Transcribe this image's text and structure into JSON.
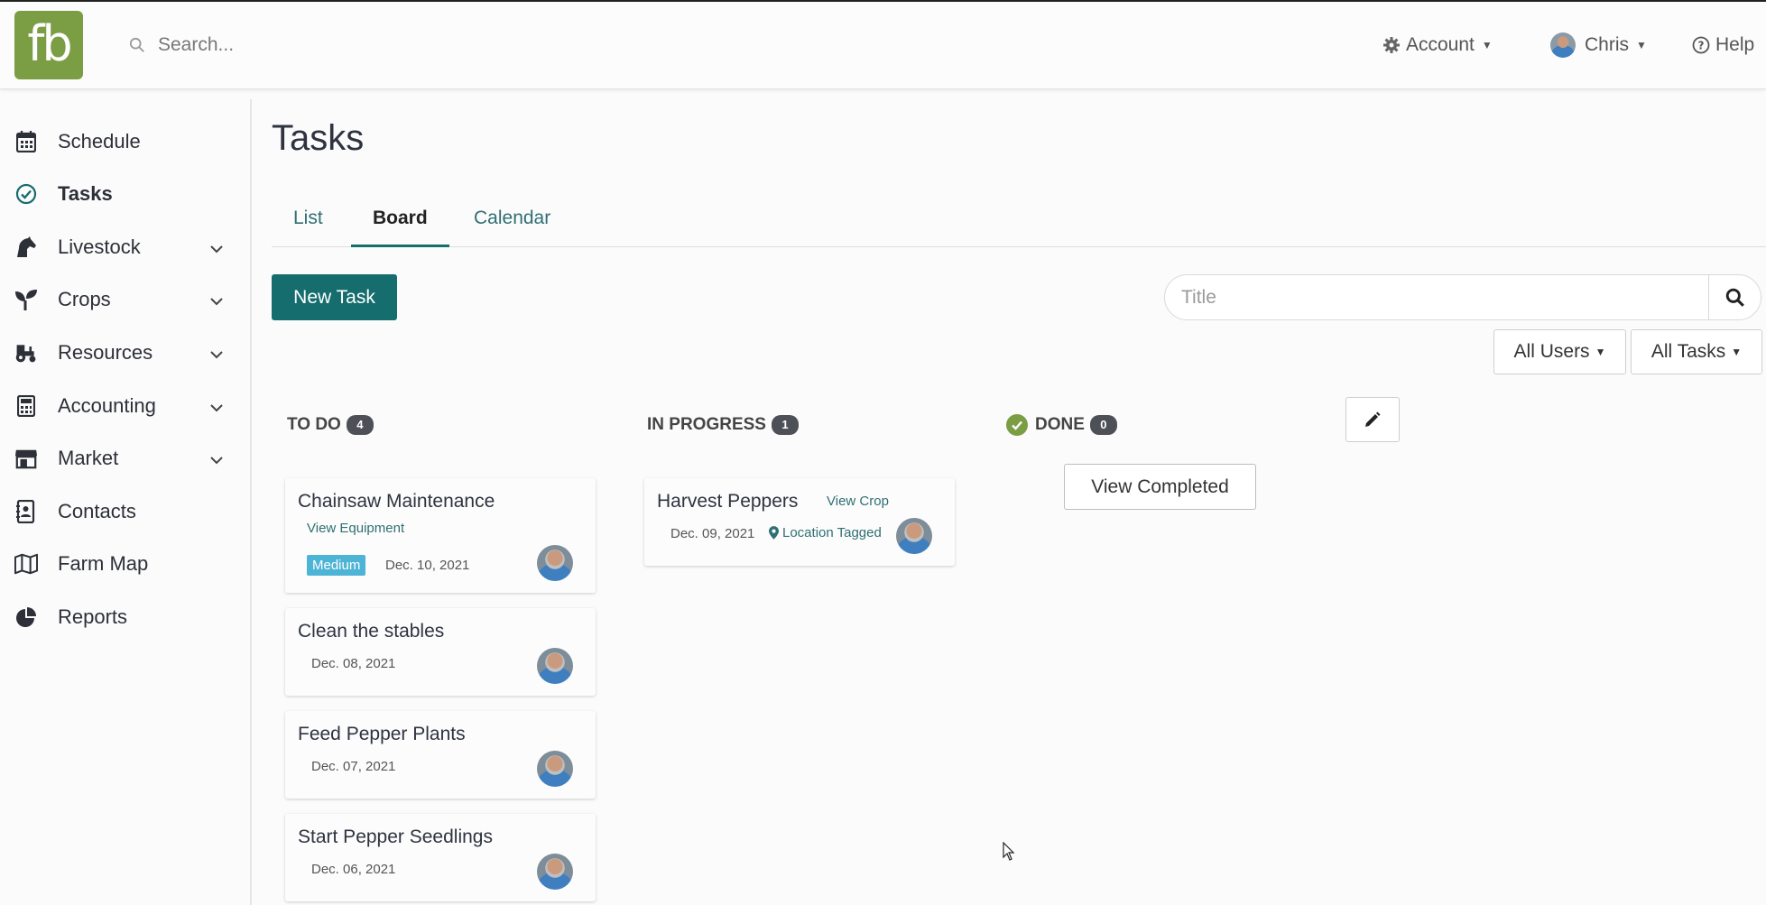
{
  "brand": {
    "logo_text": "fb",
    "color": "#7b9e45"
  },
  "search": {
    "placeholder": "Search..."
  },
  "topnav": {
    "account_label": "Account",
    "user_label": "Chris",
    "help_label": "Help"
  },
  "sidebar": {
    "items": [
      {
        "label": "Schedule",
        "icon": "calendar-icon",
        "expandable": false,
        "active": false
      },
      {
        "label": "Tasks",
        "icon": "check-circle-icon",
        "expandable": false,
        "active": true
      },
      {
        "label": "Livestock",
        "icon": "horse-icon",
        "expandable": true,
        "active": false
      },
      {
        "label": "Crops",
        "icon": "seedling-icon",
        "expandable": true,
        "active": false
      },
      {
        "label": "Resources",
        "icon": "tractor-icon",
        "expandable": true,
        "active": false
      },
      {
        "label": "Accounting",
        "icon": "calculator-icon",
        "expandable": true,
        "active": false
      },
      {
        "label": "Market",
        "icon": "store-icon",
        "expandable": true,
        "active": false
      },
      {
        "label": "Contacts",
        "icon": "address-book-icon",
        "expandable": false,
        "active": false
      },
      {
        "label": "Farm Map",
        "icon": "map-icon",
        "expandable": false,
        "active": false
      },
      {
        "label": "Reports",
        "icon": "pie-chart-icon",
        "expandable": false,
        "active": false
      }
    ]
  },
  "page": {
    "title": "Tasks",
    "tabs": [
      {
        "label": "List",
        "active": false
      },
      {
        "label": "Board",
        "active": true
      },
      {
        "label": "Calendar",
        "active": false
      }
    ],
    "new_task_label": "New Task",
    "title_search_placeholder": "Title",
    "filters": {
      "users": "All Users",
      "tasks": "All Tasks"
    }
  },
  "board": {
    "columns": [
      {
        "name": "TO DO",
        "count": "4"
      },
      {
        "name": "IN PROGRESS",
        "count": "1"
      },
      {
        "name": "DONE",
        "count": "0"
      }
    ],
    "view_completed_label": "View Completed",
    "todo_cards": [
      {
        "title": "Chainsaw Maintenance",
        "link": "View Equipment",
        "priority": "Medium",
        "date": "Dec. 10, 2021"
      },
      {
        "title": "Clean the stables",
        "date": "Dec. 08, 2021"
      },
      {
        "title": "Feed Pepper Plants",
        "date": "Dec. 07, 2021"
      },
      {
        "title": "Start Pepper Seedlings",
        "date": "Dec. 06, 2021"
      }
    ],
    "in_progress_cards": [
      {
        "title": "Harvest Peppers",
        "link": "View Crop",
        "date": "Dec. 09, 2021",
        "location": "Location Tagged"
      }
    ]
  },
  "colors": {
    "primary": "#166d6e",
    "accent": "#7b9e45",
    "badge_medium": "#4eb4d6"
  }
}
